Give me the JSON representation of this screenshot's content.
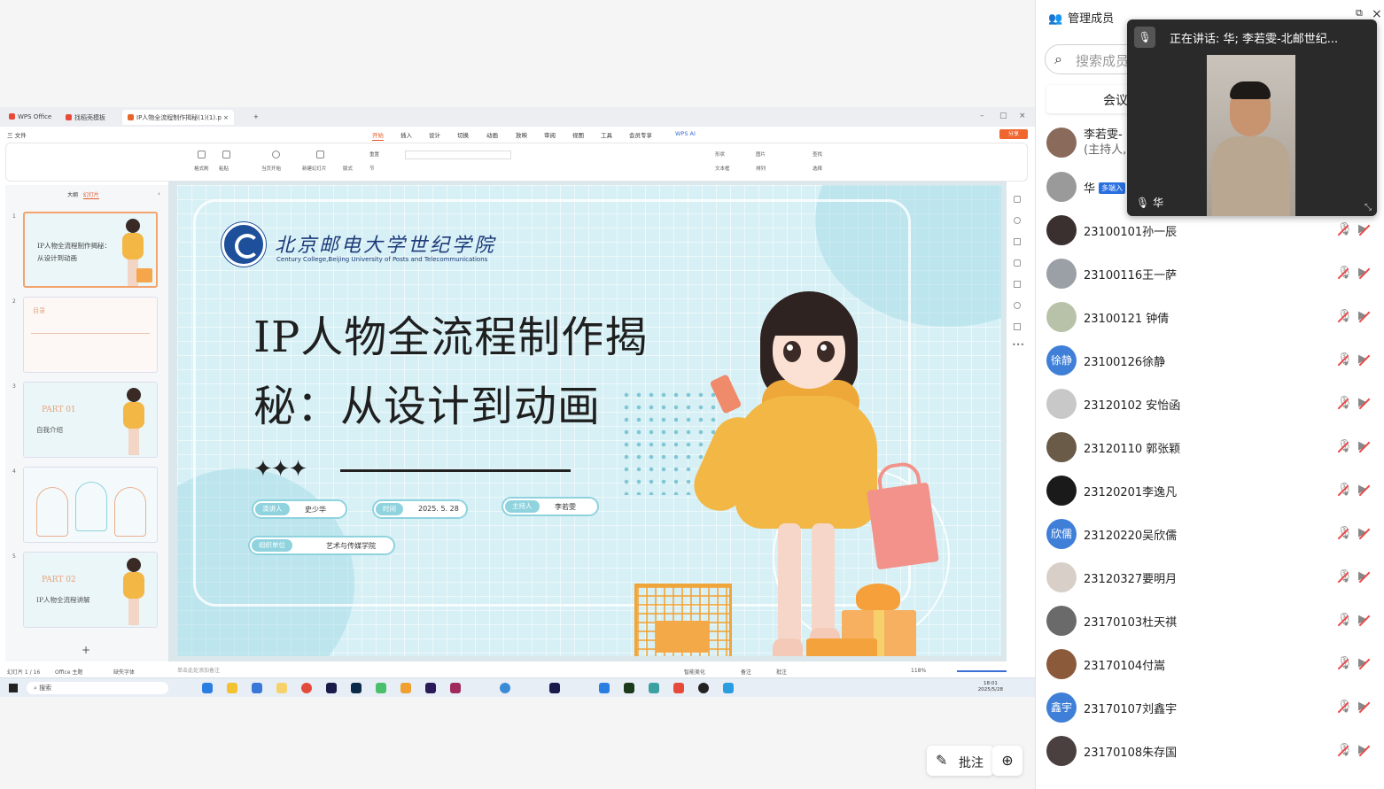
{
  "wps": {
    "tabs": [
      {
        "label": "WPS Office",
        "color": "#e84a3a"
      },
      {
        "label": "找稻壳模板",
        "color": "#e84a3a"
      },
      {
        "label": "IP人物全流程制作揭秘(1)(1).p",
        "color": "#e8652a"
      }
    ],
    "new_tab": "+",
    "file_menu": "三 文件",
    "menu": [
      "开始",
      "插入",
      "设计",
      "切换",
      "动画",
      "放映",
      "审阅",
      "视图",
      "工具",
      "会员专享",
      "WPS AI"
    ],
    "share_label": "分享",
    "ribbon": {
      "format_painter": "格式刷",
      "paste": "粘贴",
      "play_from_current": "当页开始",
      "new_slide": "新建幻灯片",
      "layout": "版式",
      "section": "节",
      "reset": "重置",
      "shape": "形状",
      "image": "图片",
      "textbox": "文本框",
      "arrange": "排列",
      "find": "查找",
      "select": "选择"
    }
  },
  "thumbs": {
    "tab_outline": "大纲",
    "tab_slides": "幻灯片",
    "items": [
      {
        "num": "1",
        "title": "IP人物全流程制作揭秘：从设计到动画"
      },
      {
        "num": "2",
        "title": "目录"
      },
      {
        "num": "3",
        "part": "PART 01",
        "sub": "自我介绍"
      },
      {
        "num": "4",
        "title": ""
      },
      {
        "num": "5",
        "part": "PART 02",
        "sub": "IP人物全流程讲解"
      }
    ],
    "add": "+"
  },
  "slide": {
    "university_cn": "北京邮电大学世纪学院",
    "university_en": "Century College,Beijing University of Posts and Telecommunications",
    "title_line1": "IP人物全流程制作揭",
    "title_line2": "秘：从设计到动画",
    "stars": "✦✦✦",
    "presenter_label": "演讲人",
    "presenter": "史少华",
    "time_label": "时间",
    "time": "2025. 5. 28",
    "host_label": "主持人",
    "host": "李若雯",
    "org_label": "组织单位",
    "org": "艺术与传媒学院"
  },
  "notes_placeholder": "单击此处添加备注",
  "status": {
    "slide_count": "幻灯片 1 / 16",
    "theme": "Office 主题",
    "font_missing": "缺失字体",
    "beautify": "智能美化",
    "notes": "备注",
    "comment": "批注",
    "zoom": "118%"
  },
  "taskbar": {
    "search": "搜索",
    "time": "18:01",
    "date": "2025/5/28"
  },
  "floating": {
    "annotate": "批注",
    "annotate_icon": "✎",
    "zoom_icon": "⊕"
  },
  "panel": {
    "title": "管理成员",
    "search_placeholder": "搜索成员",
    "meeting_tab": "会议",
    "members": [
      {
        "name": "李若雯-",
        "sub": "(主持人,",
        "avatar_color": "#8a6a5a",
        "avatar_text": ""
      },
      {
        "name": "华",
        "tag": "多端入",
        "avatar_color": "#9a9a9a",
        "avatar_text": ""
      },
      {
        "name": "23100101孙一辰",
        "avatar_color": "#3a3030",
        "avatar_text": ""
      },
      {
        "name": "23100116王一萨",
        "avatar_color": "#9aa0a6",
        "avatar_text": ""
      },
      {
        "name": "23100121 钟倩",
        "avatar_color": "#b8c2a8",
        "avatar_text": ""
      },
      {
        "name": "23100126徐静",
        "avatar_color": "#3f7fd8",
        "avatar_text": "徐静"
      },
      {
        "name": "23120102 安怡函",
        "avatar_color": "#c8c8c8",
        "avatar_text": ""
      },
      {
        "name": "23120110 郭张颖",
        "avatar_color": "#6a5a48",
        "avatar_text": ""
      },
      {
        "name": "23120201李逸凡",
        "avatar_color": "#1a1a1a",
        "avatar_text": ""
      },
      {
        "name": "23120220吴欣儒",
        "avatar_color": "#3f7fd8",
        "avatar_text": "欣儒"
      },
      {
        "name": "23120327要明月",
        "avatar_color": "#d8d0c8",
        "avatar_text": ""
      },
      {
        "name": "23170103杜天祺",
        "avatar_color": "#6a6a6a",
        "avatar_text": ""
      },
      {
        "name": "23170104付嵩",
        "avatar_color": "#8a5a3a",
        "avatar_text": ""
      },
      {
        "name": "23170107刘鑫宇",
        "avatar_color": "#3f7fd8",
        "avatar_text": "鑫宇"
      },
      {
        "name": "23170108朱存国",
        "avatar_color": "#4a4040",
        "avatar_text": ""
      }
    ],
    "mic_icon": "🎤",
    "cam_icon": "▶"
  },
  "video": {
    "speaking": "正在讲话:  华; 李若雯-北邮世纪...",
    "name": "华",
    "mic_icon": "🎤"
  }
}
